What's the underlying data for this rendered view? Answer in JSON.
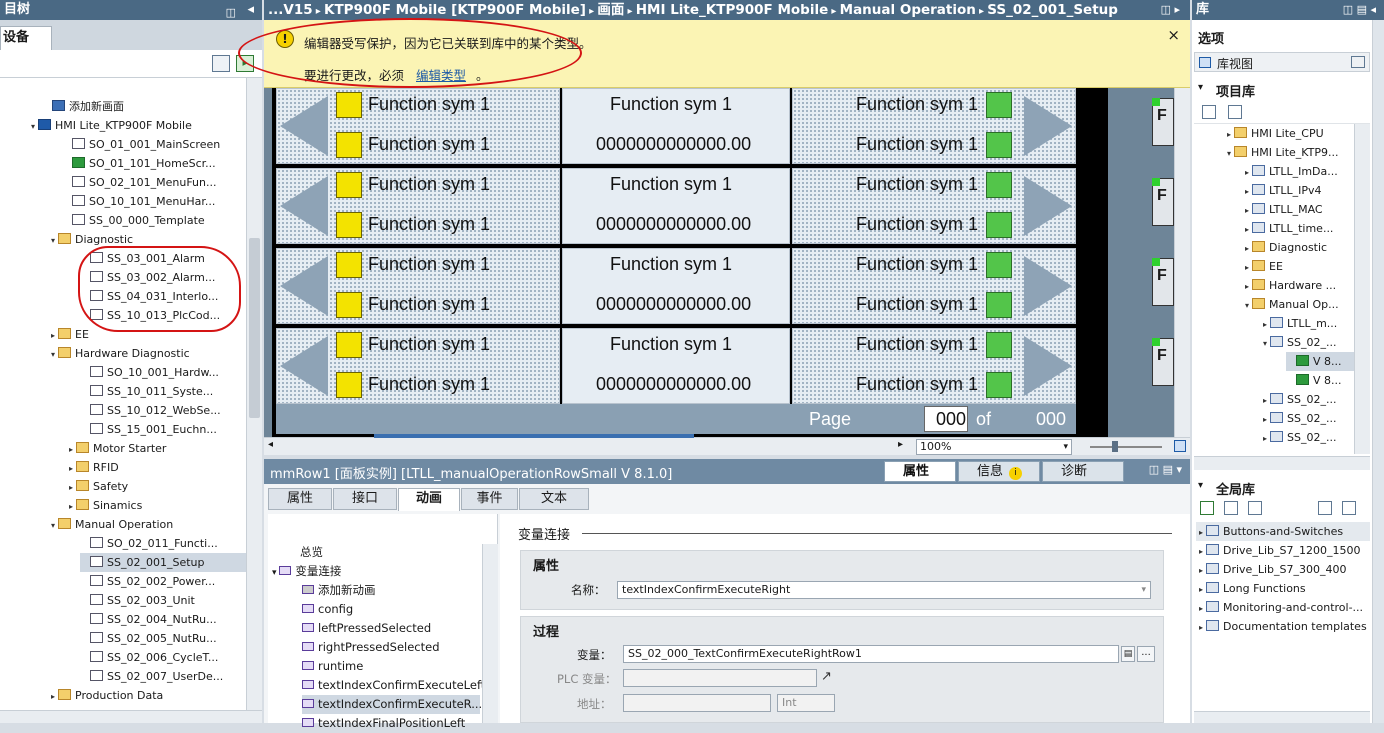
{
  "left_panel": {
    "title": "目树",
    "devices_tab": "设备",
    "tree": [
      {
        "label": "添加新画面",
        "icon": "add"
      },
      {
        "label": "HMI Lite_KTP900F Mobile",
        "icon": "dev"
      },
      {
        "label": "SO_01_001_MainScreen",
        "icon": "screen"
      },
      {
        "label": "SO_01_101_HomeScr...",
        "icon": "home"
      },
      {
        "label": "SO_02_101_MenuFun...",
        "icon": "screen"
      },
      {
        "label": "SO_10_101_MenuHar...",
        "icon": "screen"
      },
      {
        "label": "SS_00_000_Template",
        "icon": "screen"
      },
      {
        "label": "Diagnostic",
        "icon": "folder"
      },
      {
        "label": "SS_03_001_Alarm",
        "icon": "screen"
      },
      {
        "label": "SS_03_002_Alarm...",
        "icon": "screen"
      },
      {
        "label": "SS_04_031_Interlo...",
        "icon": "screen"
      },
      {
        "label": "SS_10_013_PlcCod...",
        "icon": "screen"
      },
      {
        "label": "EE",
        "icon": "folder"
      },
      {
        "label": "Hardware Diagnostic",
        "icon": "folder"
      },
      {
        "label": "SO_10_001_Hardw...",
        "icon": "screen"
      },
      {
        "label": "SS_10_011_Syste...",
        "icon": "screen"
      },
      {
        "label": "SS_10_012_WebSe...",
        "icon": "screen"
      },
      {
        "label": "SS_15_001_Euchn...",
        "icon": "screen"
      },
      {
        "label": "Motor Starter",
        "icon": "folder"
      },
      {
        "label": "RFID",
        "icon": "folder"
      },
      {
        "label": "Safety",
        "icon": "folder"
      },
      {
        "label": "Sinamics",
        "icon": "folder"
      },
      {
        "label": "Manual Operation",
        "icon": "folder"
      },
      {
        "label": "SO_02_011_Functi...",
        "icon": "screen"
      },
      {
        "label": "SS_02_001_Setup",
        "icon": "screen"
      },
      {
        "label": "SS_02_002_Power...",
        "icon": "screen"
      },
      {
        "label": "SS_02_003_Unit",
        "icon": "screen"
      },
      {
        "label": "SS_02_004_NutRu...",
        "icon": "screen"
      },
      {
        "label": "SS_02_005_NutRu...",
        "icon": "screen"
      },
      {
        "label": "SS_02_006_CycleT...",
        "icon": "screen"
      },
      {
        "label": "SS_02_007_UserDe...",
        "icon": "screen"
      },
      {
        "label": "Production Data",
        "icon": "folder"
      }
    ]
  },
  "editor": {
    "breadcrumb": [
      "...V15",
      "KTP900F Mobile [KTP900F Mobile]",
      "画面",
      "HMI Lite_KTP900F Mobile",
      "Manual Operation",
      "SS_02_001_Setup"
    ],
    "warning_line1": "编辑器受写保护，因为它已关联到库中的某个类型。",
    "warning_line2": "要进行更改，必须",
    "warning_link": "编辑类型",
    "warning_end": "。",
    "close": "×",
    "function_label": "Function sym 1",
    "value_label": "0000000000000.00",
    "page_label": "Page",
    "page_current": "000",
    "page_of": "of",
    "page_total": "000",
    "side_button": "F",
    "zoom": "100%"
  },
  "inspector": {
    "title": "mmRow1 [面板实例] [LTLL_manualOperationRowSmall V 8.1.0]",
    "header_tabs": [
      "属性",
      "信息",
      "诊断"
    ],
    "tabs": [
      "属性",
      "接口",
      "动画",
      "事件",
      "文本"
    ],
    "active_tab": 2,
    "nav": [
      {
        "label": "总览"
      },
      {
        "label": "变量连接"
      },
      {
        "label": "添加新动画"
      },
      {
        "label": "config"
      },
      {
        "label": "leftPressedSelected"
      },
      {
        "label": "rightPressedSelected"
      },
      {
        "label": "runtime"
      },
      {
        "label": "textIndexConfirmExecuteLeft"
      },
      {
        "label": "textIndexConfirmExecuteR..."
      },
      {
        "label": "textIndexFinalPositionLeft"
      }
    ],
    "section_title": "变量连接",
    "group_properties": "属性",
    "name_label": "名称：",
    "name_value": "textIndexConfirmExecuteRight",
    "group_process": "过程",
    "var_label": "变量：",
    "var_value": "SS_02_000_TextConfirmExecuteRightRow1",
    "plc_var_label": "PLC 变量：",
    "address_label": "地址：",
    "address_type": "Int"
  },
  "right_panel": {
    "title": "库",
    "options_label": "选项",
    "lib_view_label": "库视图",
    "project_lib": "项目库",
    "project_items": [
      {
        "label": "HMI Lite_CPU"
      },
      {
        "label": "HMI Lite_KTP9..."
      },
      {
        "label": "LTLL_ImDa..."
      },
      {
        "label": "LTLL_IPv4"
      },
      {
        "label": "LTLL_MAC"
      },
      {
        "label": "LTLL_time..."
      },
      {
        "label": "Diagnostic"
      },
      {
        "label": "EE"
      },
      {
        "label": "Hardware ..."
      },
      {
        "label": "Manual Op..."
      },
      {
        "label": "LTLL_m..."
      },
      {
        "label": "SS_02_..."
      },
      {
        "label": "V 8..."
      },
      {
        "label": "V 8..."
      },
      {
        "label": "SS_02_..."
      },
      {
        "label": "SS_02_..."
      },
      {
        "label": "SS_02_..."
      }
    ],
    "global_lib": "全局库",
    "global_items": [
      {
        "label": "Buttons-and-Switches"
      },
      {
        "label": "Drive_Lib_S7_1200_1500"
      },
      {
        "label": "Drive_Lib_S7_300_400"
      },
      {
        "label": "Long Functions"
      },
      {
        "label": "Monitoring-and-control-..."
      },
      {
        "label": "Documentation templates"
      }
    ]
  },
  "colors": {
    "header_bg": "#4a6984",
    "warning_bg": "#fbf4b4",
    "annotation": "#d41414",
    "yellow_box": "#f3e300",
    "green_box": "#53c54a"
  }
}
